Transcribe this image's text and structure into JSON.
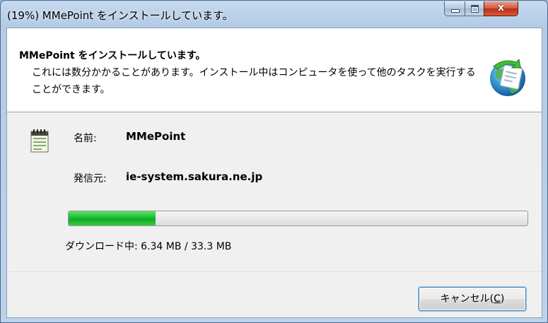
{
  "window": {
    "title": "(19%) MMePoint をインストールしています。",
    "buttons": {
      "minimize_icon": "minimize-icon",
      "maximize_icon": "maximize-icon",
      "close_glyph": "x"
    }
  },
  "header": {
    "title": "MMePoint をインストールしています。",
    "description": "これには数分かかることがあります。インストール中はコンピュータを使って他のタスクを実行することができます。",
    "icon": "install-globe-icon"
  },
  "details": {
    "icon": "calendar-app-icon",
    "name_label": "名前:",
    "name_value": "MMePoint",
    "publisher_label": "発信元:",
    "publisher_value": "ie-system.sakura.ne.jp"
  },
  "progress": {
    "percent": 19,
    "status": "ダウンロード中: 6.34 MB / 33.3 MB"
  },
  "footer": {
    "cancel_label": "キャンセル(",
    "cancel_accel": "C",
    "cancel_close": ")"
  },
  "colors": {
    "progress_fill": "#15bf2c",
    "title_bar": "#b3cbe5"
  }
}
